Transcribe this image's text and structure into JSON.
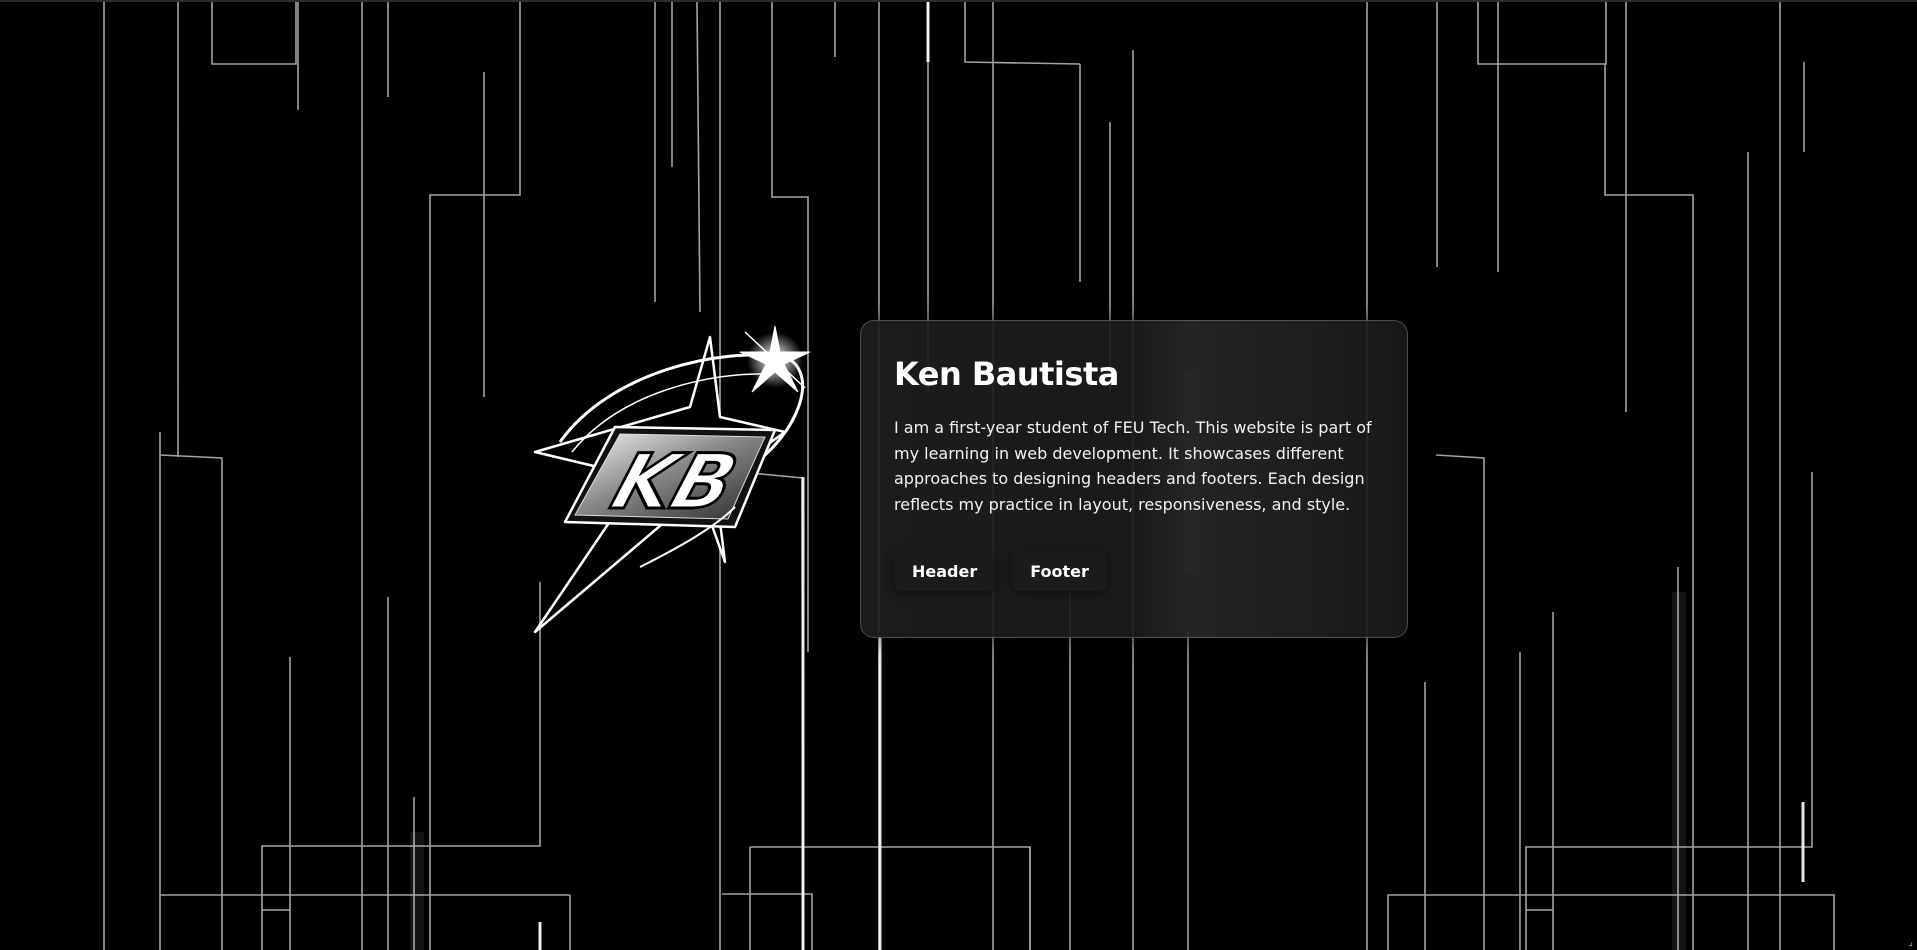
{
  "card": {
    "name": "Ken Bautista",
    "description": "I am a first-year student of FEU Tech. This website is part of my learning in web development. It showcases different approaches to designing headers and footers. Each design reflects my practice in layout, responsiveness, and style.",
    "buttons": [
      "Header",
      "Footer"
    ]
  },
  "logo": {
    "letters": "KB",
    "icon": "kb-star-logo-icon"
  },
  "background": {
    "icon": "circuit-lines-icon"
  },
  "colors": {
    "background": "#000000",
    "card": "#1e1e1e",
    "text": "#ffffff"
  }
}
